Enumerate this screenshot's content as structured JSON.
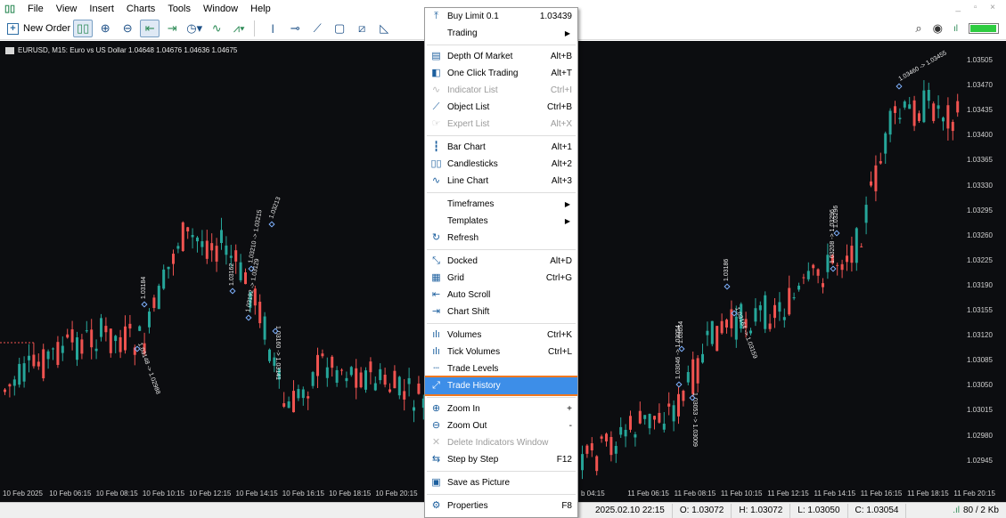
{
  "menubar": {
    "items": [
      "File",
      "View",
      "Insert",
      "Charts",
      "Tools",
      "Window",
      "Help"
    ],
    "window_controls": "_ ▫ ×"
  },
  "toolbar": {
    "new_order_label": "New Order",
    "icons": [
      "candlesticks-icon",
      "zoom-in-icon",
      "zoom-out-icon",
      "auto-scroll-icon",
      "chart-shift-icon",
      "timeframes-icon",
      "line-chart-icon",
      "indicators-icon",
      "cursor-icon",
      "crosshair-icon",
      "trendline-icon",
      "rectangle-icon",
      "fibonacci-icon",
      "triangle-icon"
    ],
    "right_icons": [
      "search-icon",
      "account-icon"
    ],
    "signal_level": 0.95
  },
  "chart": {
    "symbol_text": "EURUSD, M15:  Euro vs US Dollar  1.04648 1.04676 1.04636 1.04675",
    "colors": {
      "bull": "#26a69a",
      "bear": "#ef5350",
      "bg": "#0c0d10"
    },
    "price_levels": [
      "1.03505",
      "1.03470",
      "1.03435",
      "1.03400",
      "1.03365",
      "1.03330",
      "1.03295",
      "1.03260",
      "1.03225",
      "1.03190",
      "1.03155",
      "1.03120",
      "1.03085",
      "1.03050",
      "1.03015",
      "1.02980",
      "1.02945"
    ],
    "time_labels": [
      "10 Feb 2025",
      "10 Feb 06:15",
      "10 Feb 08:15",
      "10 Feb 10:15",
      "10 Feb 12:15",
      "10 Feb 14:15",
      "10 Feb 16:15",
      "10 Feb 18:15",
      "10 Feb 20:15",
      "b 04:15",
      "11 Feb 06:15",
      "11 Feb 08:15",
      "11 Feb 10:15",
      "11 Feb 12:15",
      "11 Feb 14:15",
      "11 Feb 16:15",
      "11 Feb 18:15",
      "11 Feb 20:15"
    ],
    "trade_annotations": [
      "1.03184",
      "1.03148 -> 1.02988",
      "1.03213",
      "1.03210 -> 1.03215",
      "1.03162",
      "1.03192 -> 1.03129",
      "1.03160 -> 1.03141",
      "1.03054",
      "1.03046 -> 1.03054",
      "1.03053 -> 1.03009",
      "1.03186",
      "1.03164 -> 1.03159",
      "1.03296",
      "1.03208 -> 1.03296",
      "1.03460 -> 1.03455"
    ]
  },
  "context_menu": {
    "items": [
      {
        "icon": "buy-limit-icon",
        "label": "Buy Limit 0.1",
        "shortcut": "1.03439",
        "submenu": false,
        "disabled": false
      },
      {
        "icon": "",
        "label": "Trading",
        "shortcut": "",
        "submenu": true,
        "disabled": false
      },
      {
        "sep": true
      },
      {
        "icon": "depth-of-market-icon",
        "label": "Depth Of Market",
        "shortcut": "Alt+B",
        "submenu": false,
        "disabled": false
      },
      {
        "icon": "one-click-trading-icon",
        "label": "One Click Trading",
        "shortcut": "Alt+T",
        "submenu": false,
        "disabled": false
      },
      {
        "icon": "indicator-list-icon",
        "label": "Indicator List",
        "shortcut": "Ctrl+I",
        "submenu": false,
        "disabled": true
      },
      {
        "icon": "object-list-icon",
        "label": "Object List",
        "shortcut": "Ctrl+B",
        "submenu": false,
        "disabled": false
      },
      {
        "icon": "expert-list-icon",
        "label": "Expert List",
        "shortcut": "Alt+X",
        "submenu": false,
        "disabled": true
      },
      {
        "sep": true
      },
      {
        "icon": "bar-chart-icon",
        "label": "Bar Chart",
        "shortcut": "Alt+1",
        "submenu": false,
        "disabled": false
      },
      {
        "icon": "candlesticks-icon",
        "label": "Candlesticks",
        "shortcut": "Alt+2",
        "submenu": false,
        "disabled": false
      },
      {
        "icon": "line-chart-icon",
        "label": "Line Chart",
        "shortcut": "Alt+3",
        "submenu": false,
        "disabled": false
      },
      {
        "sep": true
      },
      {
        "icon": "",
        "label": "Timeframes",
        "shortcut": "",
        "submenu": true,
        "disabled": false
      },
      {
        "icon": "",
        "label": "Templates",
        "shortcut": "",
        "submenu": true,
        "disabled": false
      },
      {
        "icon": "refresh-icon",
        "label": "Refresh",
        "shortcut": "",
        "submenu": false,
        "disabled": false
      },
      {
        "sep": true
      },
      {
        "icon": "docked-icon",
        "label": "Docked",
        "shortcut": "Alt+D",
        "submenu": false,
        "disabled": false
      },
      {
        "icon": "grid-icon",
        "label": "Grid",
        "shortcut": "Ctrl+G",
        "submenu": false,
        "disabled": false
      },
      {
        "icon": "auto-scroll-icon",
        "label": "Auto Scroll",
        "shortcut": "",
        "submenu": false,
        "disabled": false
      },
      {
        "icon": "chart-shift-icon",
        "label": "Chart Shift",
        "shortcut": "",
        "submenu": false,
        "disabled": false
      },
      {
        "sep": true
      },
      {
        "icon": "volumes-icon",
        "label": "Volumes",
        "shortcut": "Ctrl+K",
        "submenu": false,
        "disabled": false
      },
      {
        "icon": "tick-volumes-icon",
        "label": "Tick Volumes",
        "shortcut": "Ctrl+L",
        "submenu": false,
        "disabled": false
      },
      {
        "icon": "trade-levels-icon",
        "label": "Trade Levels",
        "shortcut": "",
        "submenu": false,
        "disabled": false
      },
      {
        "icon": "trade-history-icon",
        "label": "Trade History",
        "shortcut": "",
        "submenu": false,
        "disabled": false,
        "highlighted": true
      },
      {
        "sep": true
      },
      {
        "icon": "zoom-in-icon",
        "label": "Zoom In",
        "shortcut": "+",
        "submenu": false,
        "disabled": false
      },
      {
        "icon": "zoom-out-icon",
        "label": "Zoom Out",
        "shortcut": "-",
        "submenu": false,
        "disabled": false
      },
      {
        "icon": "delete-indicators-window-icon",
        "label": "Delete Indicators Window",
        "shortcut": "",
        "submenu": false,
        "disabled": true
      },
      {
        "icon": "step-by-step-icon",
        "label": "Step by Step",
        "shortcut": "F12",
        "submenu": false,
        "disabled": false
      },
      {
        "sep": true
      },
      {
        "icon": "save-as-picture-icon",
        "label": "Save as Picture",
        "shortcut": "",
        "submenu": false,
        "disabled": false
      },
      {
        "sep": true
      },
      {
        "icon": "properties-icon",
        "label": "Properties",
        "shortcut": "F8",
        "submenu": false,
        "disabled": false
      }
    ]
  },
  "statusbar": {
    "datetime": "2025.02.10 22:15",
    "open": "O: 1.03072",
    "high": "H: 1.03072",
    "low": "L: 1.03050",
    "close": "C: 1.03054",
    "network": "80 / 2 Kb"
  }
}
